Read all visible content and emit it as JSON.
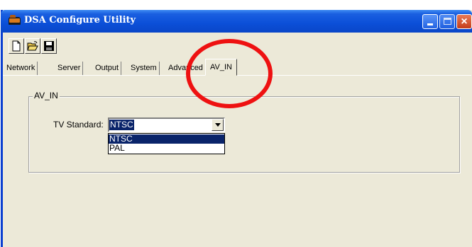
{
  "window": {
    "title": "DSA Configure Utility"
  },
  "titlebar_buttons": {
    "minimize": "minimize-icon",
    "maximize": "maximize-icon",
    "close": "×"
  },
  "toolbar": {
    "icons": [
      "new-file-icon",
      "open-folder-icon",
      "save-disk-icon"
    ]
  },
  "tabs": [
    {
      "label": "Network"
    },
    {
      "label": "Server"
    },
    {
      "label": "Output"
    },
    {
      "label": "System"
    },
    {
      "label": "Advanced"
    },
    {
      "label": "AV_IN",
      "active": true
    }
  ],
  "group": {
    "title": "AV_IN",
    "tv_standard_label": "TV Standard:",
    "selected": "NTSC",
    "options": [
      "NTSC",
      "PAL"
    ]
  },
  "annotation": {
    "color": "#ee1111"
  }
}
